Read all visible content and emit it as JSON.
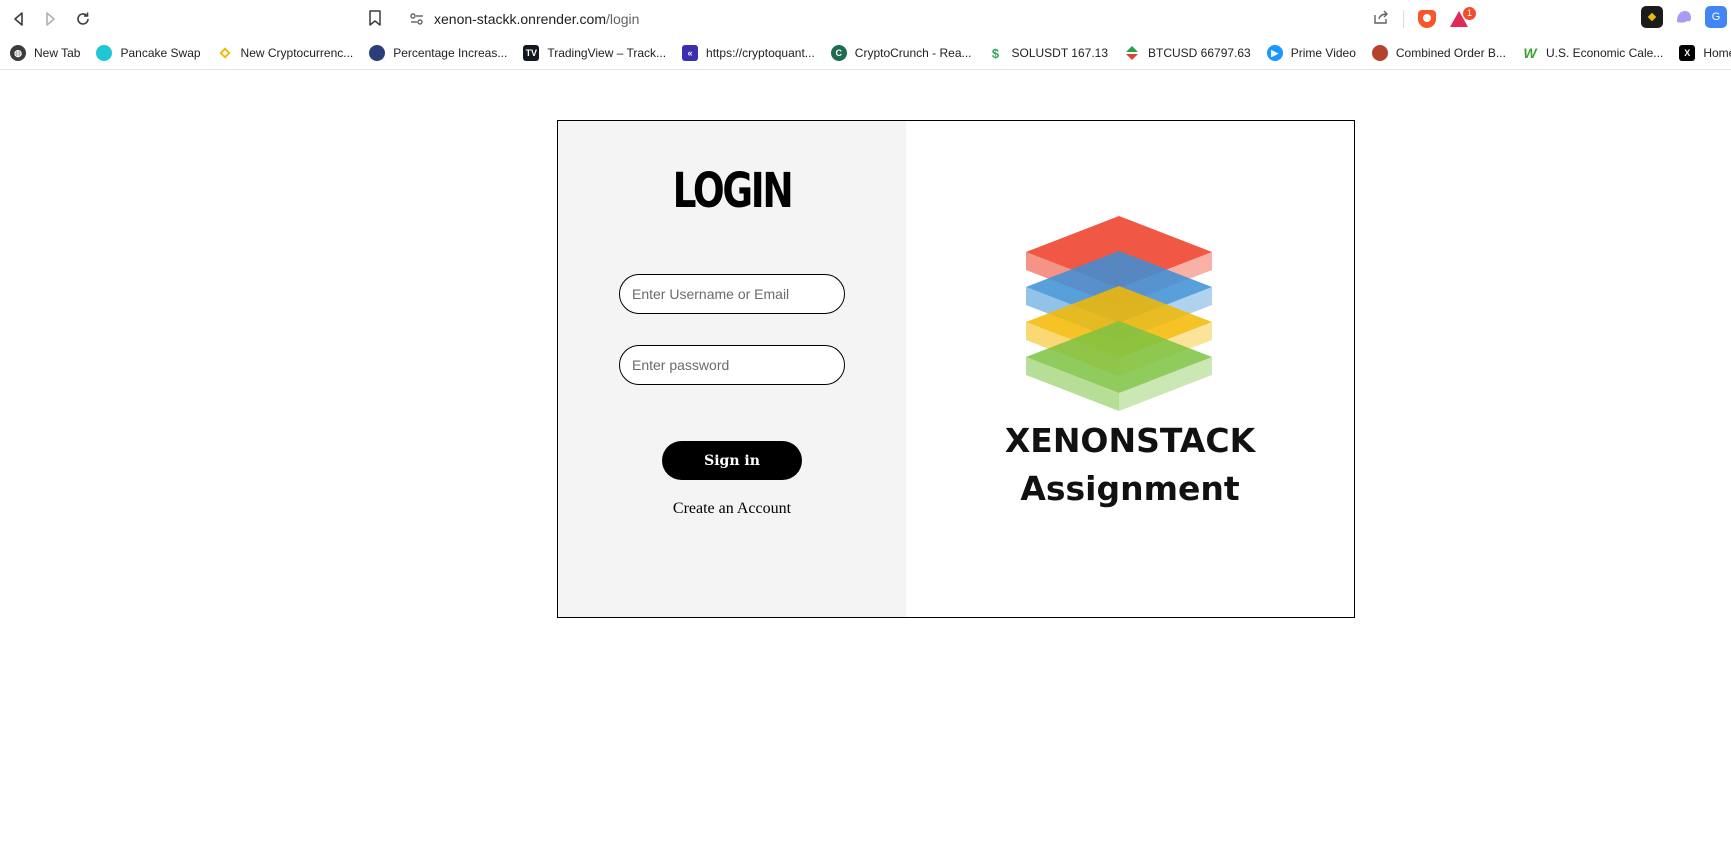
{
  "browser": {
    "url_domain": "xenon-stackk.onrender.com",
    "url_path": "/login",
    "rewards_count": "1"
  },
  "bookmarks": [
    {
      "label": "New Tab",
      "icon": "globe-icon",
      "color": "#3c3c3c"
    },
    {
      "label": "Pancake Swap",
      "icon": "pancake-icon",
      "color": "#1fc7d4"
    },
    {
      "label": "New Cryptocurrenc...",
      "icon": "binance-icon",
      "color": "#f0b90b"
    },
    {
      "label": "Percentage Increas...",
      "icon": "calc-icon",
      "color": "#2a3f7a"
    },
    {
      "label": "TradingView – Track...",
      "icon": "tradingview-icon",
      "color": "#131722"
    },
    {
      "label": "https://cryptoquant...",
      "icon": "cryptoquant-icon",
      "color": "#3b2fb0"
    },
    {
      "label": "CryptoCrunch - Rea...",
      "icon": "cryptocrunch-icon",
      "color": "#1e6b52"
    },
    {
      "label": "SOLUSDT 167.13",
      "icon": "sol-icon",
      "color": "#3ba55d"
    },
    {
      "label": "BTCUSD 66797.63",
      "icon": "btc-icon",
      "color": "#d9442f"
    },
    {
      "label": "Prime Video",
      "icon": "prime-icon",
      "color": "#1a98ff"
    },
    {
      "label": "Combined Order B...",
      "icon": "orderbook-icon",
      "color": "#b5432c"
    },
    {
      "label": "U.S. Economic Cale...",
      "icon": "w-icon",
      "color": "#3aa335"
    },
    {
      "label": "Home / Twitt",
      "icon": "x-icon",
      "color": "#000000"
    }
  ],
  "login": {
    "title": "LOGIN",
    "username_placeholder": "Enter Username or Email",
    "password_placeholder": "Enter password",
    "signin_label": "Sign in",
    "create_account_label": "Create an Account"
  },
  "brand": {
    "line1": "XENONSTACK",
    "line2": "Assignment",
    "logo_colors": {
      "red": "#ee3a24",
      "blue": "#3b8fd6",
      "yellow": "#f5b800",
      "green": "#7cc242"
    }
  }
}
